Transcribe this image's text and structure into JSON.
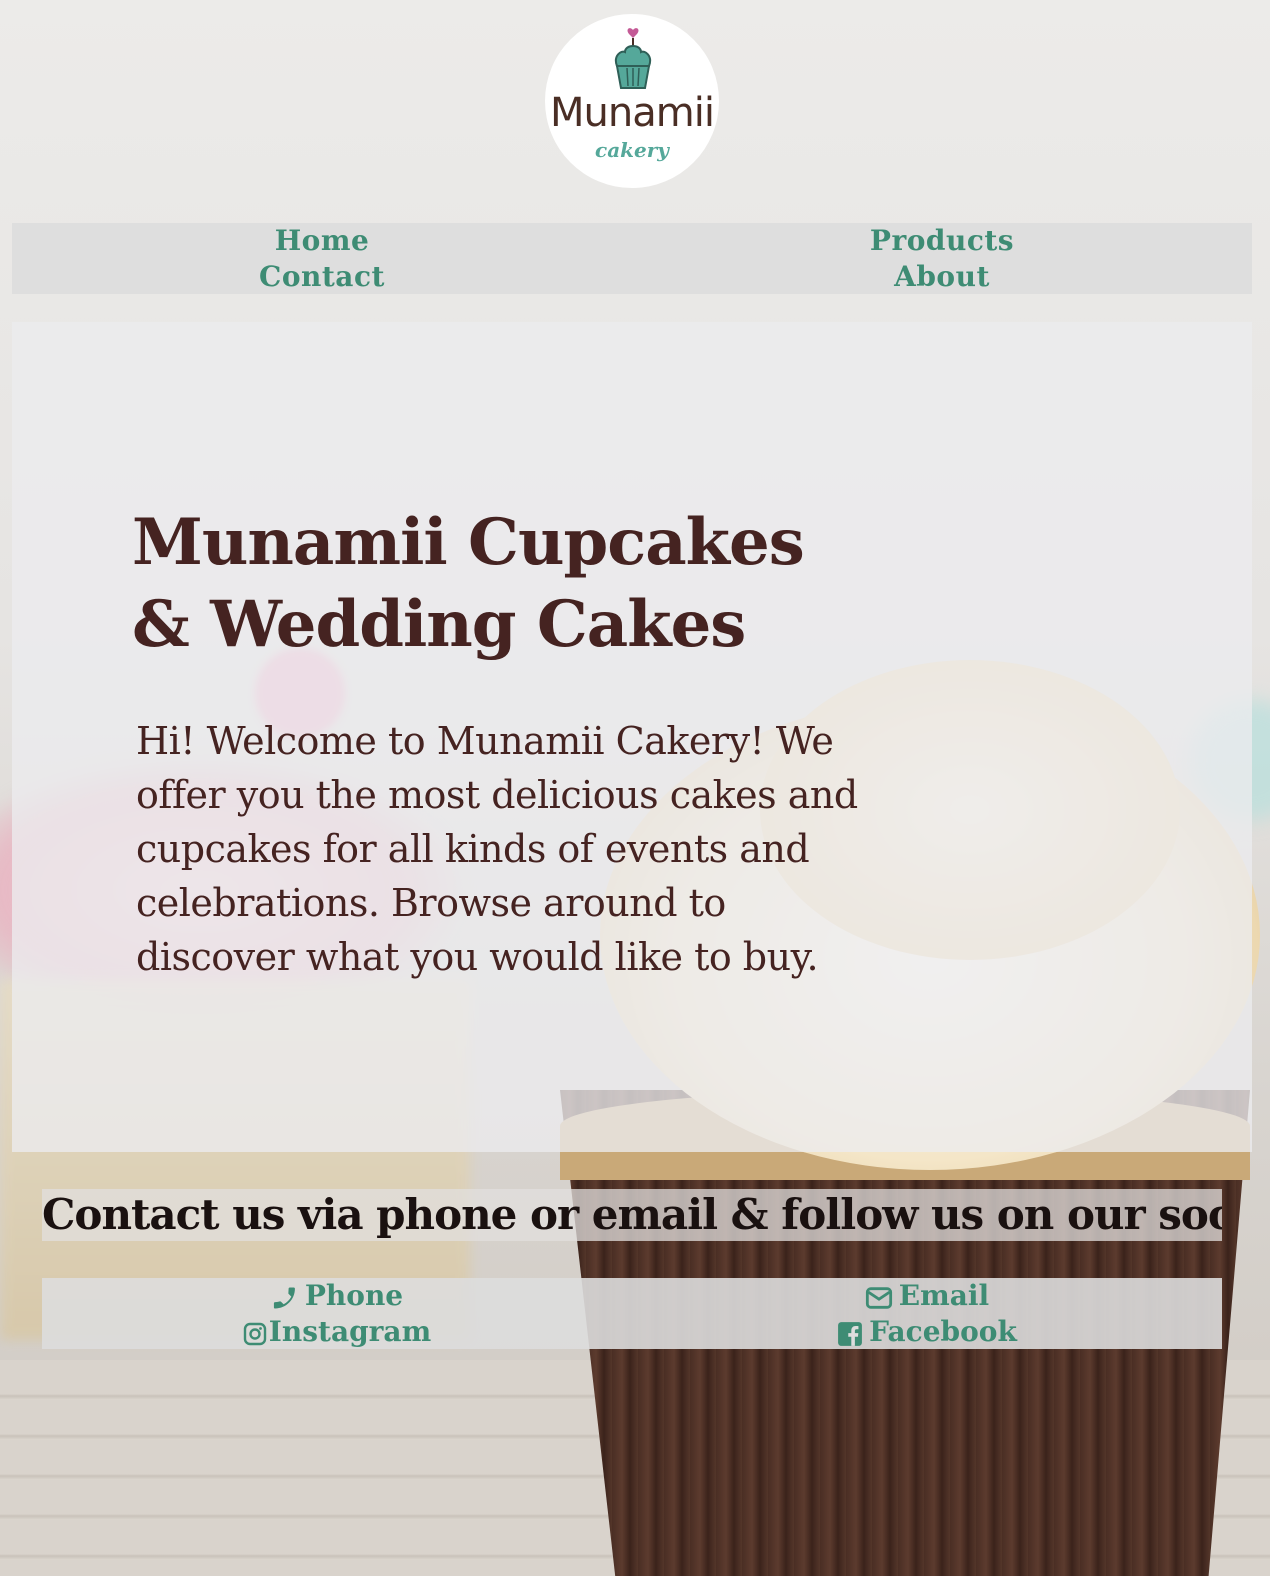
{
  "brand": {
    "logo_name": "Munamii",
    "logo_sub": "cakery"
  },
  "nav": {
    "items": [
      {
        "label": "Home"
      },
      {
        "label": "Products"
      },
      {
        "label": "Contact"
      },
      {
        "label": "About"
      }
    ]
  },
  "hero": {
    "title": "Munamii Cupcakes & Wedding Cakes",
    "intro": "Hi! Welcome to Munamii Cakery! We offer you the most delicious cakes and cupcakes for all kinds of events and celebrations. Browse around to discover what you would like to buy."
  },
  "contact": {
    "heading": "Contact us via phone or email & follow us on our social media!",
    "links": [
      {
        "label": "Phone",
        "icon": "phone-icon"
      },
      {
        "label": "Email",
        "icon": "envelope-icon"
      },
      {
        "label": "Instagram",
        "icon": "instagram-icon"
      },
      {
        "label": "Facebook",
        "icon": "facebook-icon"
      }
    ]
  },
  "colors": {
    "link": "#3e8c74",
    "heading": "#452321",
    "logo_mint": "#55a89a"
  }
}
